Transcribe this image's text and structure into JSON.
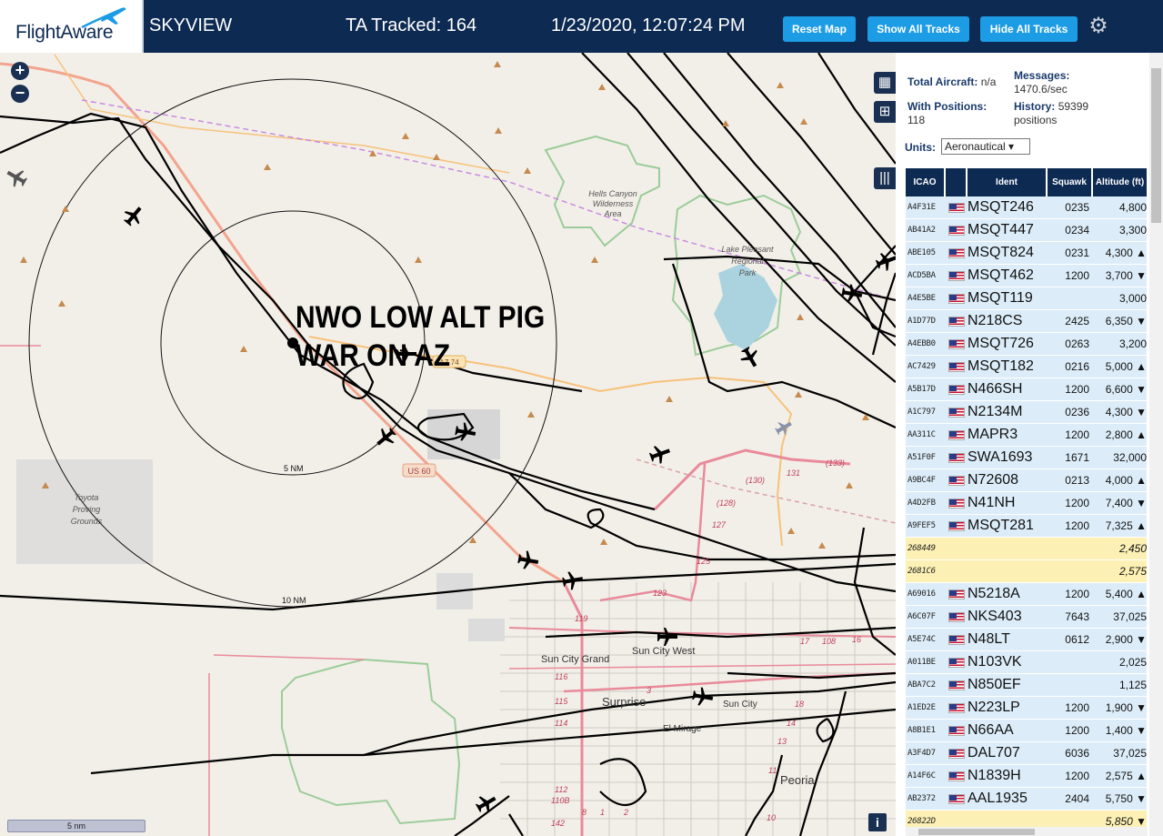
{
  "header": {
    "logo_text": "FlightAware",
    "app_title": "SKYVIEW",
    "tracked": "TA Tracked: 164",
    "datetime": "1/23/2020, 12:07:24 PM",
    "btn_reset": "Reset Map",
    "btn_show": "Show All Tracks",
    "btn_hide": "Hide All Tracks",
    "settings_icon": "gear-icon"
  },
  "map": {
    "overlay_text": [
      "NWO LOW ALT PIG",
      "WAR ON AZ"
    ],
    "range_5": "5 NM",
    "range_10": "10 NM",
    "scale": "5 nm",
    "labels": {
      "hells_canyon": [
        "Hells Canyon",
        "Wilderness",
        "Area"
      ],
      "lake": [
        "Lake Pleasant",
        "Regional",
        "Park"
      ],
      "toyota": [
        "Toyota",
        "Proving",
        "Grounds"
      ],
      "sun_city_grand": "Sun City Grand",
      "sun_city_west": "Sun City West",
      "surprise": "Surprise",
      "sun_city": "Sun City",
      "el_mirage": "El Mirage",
      "peoria": "Peoria",
      "us60": "US 60",
      "az74": "AZ 74"
    },
    "route_numbers": [
      "131",
      "(130)",
      "(133)",
      "(128)",
      "127",
      "125",
      "123",
      "119",
      "116",
      "115",
      "114",
      "112",
      "110B",
      "108",
      "17",
      "16",
      "18",
      "14",
      "13",
      "11",
      "10",
      "8",
      "1",
      "2",
      "3",
      "142"
    ]
  },
  "panel": {
    "total_label": "Total Aircraft:",
    "total_value": "n/a",
    "messages_label": "Messages:",
    "messages_value": "1470.6/sec",
    "positions_label": "With Positions:",
    "positions_value": "118",
    "history_label": "History:",
    "history_value": "59399",
    "history_unit": "positions",
    "units_label": "Units:",
    "units_value": "Aeronautical ▾"
  },
  "table": {
    "headers": {
      "icao": "ICAO",
      "ident": "Ident",
      "squawk": "Squawk",
      "altitude": "Altitude (ft)"
    },
    "rows": [
      {
        "icao": "A4F31E",
        "flag": true,
        "ident": "MSQT246",
        "squawk": "0235",
        "alt": "4,800",
        "style": "blue"
      },
      {
        "icao": "AB41A2",
        "flag": true,
        "ident": "MSQT447",
        "squawk": "0234",
        "alt": "3,300",
        "style": "blue"
      },
      {
        "icao": "ABE105",
        "flag": true,
        "ident": "MSQT824",
        "squawk": "0231",
        "alt": "4,300 ▲",
        "style": "blue"
      },
      {
        "icao": "ACD5BA",
        "flag": true,
        "ident": "MSQT462",
        "squawk": "1200",
        "alt": "3,700 ▼",
        "style": "blue"
      },
      {
        "icao": "A4E5BE",
        "flag": true,
        "ident": "MSQT119",
        "squawk": "",
        "alt": "3,000",
        "style": "blue"
      },
      {
        "icao": "A1D77D",
        "flag": true,
        "ident": "N218CS",
        "squawk": "2425",
        "alt": "6,350 ▼",
        "style": "blue"
      },
      {
        "icao": "A4EBB0",
        "flag": true,
        "ident": "MSQT726",
        "squawk": "0263",
        "alt": "3,200",
        "style": "blue"
      },
      {
        "icao": "AC7429",
        "flag": true,
        "ident": "MSQT182",
        "squawk": "0216",
        "alt": "5,000 ▲",
        "style": "blue"
      },
      {
        "icao": "A5B17D",
        "flag": true,
        "ident": "N466SH",
        "squawk": "1200",
        "alt": "6,600 ▼",
        "style": "blue"
      },
      {
        "icao": "A1C797",
        "flag": true,
        "ident": "N2134M",
        "squawk": "0236",
        "alt": "4,300 ▼",
        "style": "blue"
      },
      {
        "icao": "AA311C",
        "flag": true,
        "ident": "MAPR3",
        "squawk": "1200",
        "alt": "2,800 ▲",
        "style": "blue"
      },
      {
        "icao": "A51F0F",
        "flag": true,
        "ident": "SWA1693",
        "squawk": "1671",
        "alt": "32,000",
        "style": "blue"
      },
      {
        "icao": "A9BC4F",
        "flag": true,
        "ident": "N72608",
        "squawk": "0213",
        "alt": "4,000 ▲",
        "style": "blue"
      },
      {
        "icao": "A4D2FB",
        "flag": true,
        "ident": "N41NH",
        "squawk": "1200",
        "alt": "7,400 ▼",
        "style": "blue"
      },
      {
        "icao": "A9FEF5",
        "flag": true,
        "ident": "MSQT281",
        "squawk": "1200",
        "alt": "7,325 ▲",
        "style": "blue"
      },
      {
        "icao": "268449",
        "flag": false,
        "ident": "",
        "squawk": "",
        "alt": "2,450",
        "style": "yel"
      },
      {
        "icao": "2681C6",
        "flag": false,
        "ident": "",
        "squawk": "",
        "alt": "2,575",
        "style": "yel"
      },
      {
        "icao": "A69016",
        "flag": true,
        "ident": "N5218A",
        "squawk": "1200",
        "alt": "5,400 ▲",
        "style": "blue"
      },
      {
        "icao": "A6C07F",
        "flag": true,
        "ident": "NKS403",
        "squawk": "7643",
        "alt": "37,025",
        "style": "blue"
      },
      {
        "icao": "A5E74C",
        "flag": true,
        "ident": "N48LT",
        "squawk": "0612",
        "alt": "2,900 ▼",
        "style": "blue"
      },
      {
        "icao": "A011BE",
        "flag": true,
        "ident": "N103VK",
        "squawk": "",
        "alt": "2,025",
        "style": "blue"
      },
      {
        "icao": "ABA7C2",
        "flag": true,
        "ident": "N850EF",
        "squawk": "",
        "alt": "1,125",
        "style": "blue"
      },
      {
        "icao": "A1ED2E",
        "flag": true,
        "ident": "N223LP",
        "squawk": "1200",
        "alt": "1,900 ▼",
        "style": "blue"
      },
      {
        "icao": "A8B1E1",
        "flag": true,
        "ident": "N66AA",
        "squawk": "1200",
        "alt": "1,400 ▼",
        "style": "blue"
      },
      {
        "icao": "A3F4D7",
        "flag": true,
        "ident": "DAL707",
        "squawk": "6036",
        "alt": "37,025",
        "style": "blue"
      },
      {
        "icao": "A14F6C",
        "flag": true,
        "ident": "N1839H",
        "squawk": "1200",
        "alt": "2,575 ▲",
        "style": "blue"
      },
      {
        "icao": "AB2372",
        "flag": true,
        "ident": "AAL1935",
        "squawk": "2404",
        "alt": "5,750 ▼",
        "style": "blue"
      },
      {
        "icao": "26822D",
        "flag": false,
        "ident": "",
        "squawk": "",
        "alt": "5,850 ▼",
        "style": "yel"
      }
    ]
  }
}
